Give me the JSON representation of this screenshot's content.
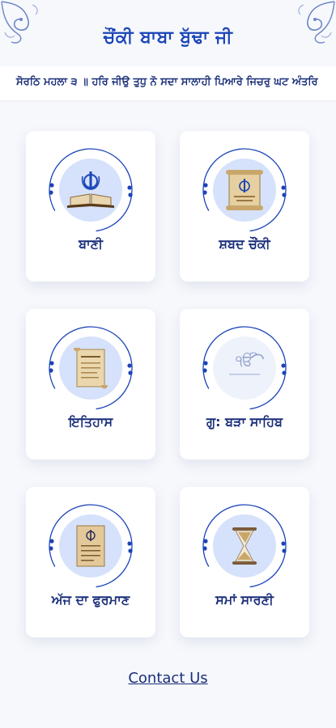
{
  "header": {
    "title": "ਚੌਂਕੀ ਬਾਬਾ ਬੁੱਢਾ ਜੀ"
  },
  "ticker": {
    "text": "ਸੋਰਠਿ ਮਹਲਾ ੩ ॥ ਹਰਿ ਜੀਉ ਤੁਧੁ ਨੋ ਸਦਾ ਸਾਲਾਹੀ ਪਿਆਰੇ ਜਿਚਰੁ ਘਟ ਅੰਤਰਿ"
  },
  "cards": [
    {
      "label": "ਬਾਣੀ",
      "icon": "book-khanda-icon"
    },
    {
      "label": "ਸ਼ਬਦ ਚੌਂਕੀ",
      "icon": "scroll-khanda-icon"
    },
    {
      "label": "ਇਤਿਹਾਸ",
      "icon": "history-scroll-icon"
    },
    {
      "label": "ਗੁ: ਬੜਾ ਸਾਹਿਬ",
      "icon": "ik-onkar-icon"
    },
    {
      "label": "ਅੱਜ ਦਾ ਫੁਰਮਾਣ",
      "icon": "hukamnama-paper-icon"
    },
    {
      "label": "ਸਮਾਂ ਸਾਰਣੀ",
      "icon": "hourglass-icon"
    }
  ],
  "footer": {
    "contact_label": "Contact Us"
  },
  "colors": {
    "accent": "#1a44b8",
    "text": "#1b2f7a",
    "disk": "#d6e2fb",
    "background": "#f6f8fc"
  }
}
